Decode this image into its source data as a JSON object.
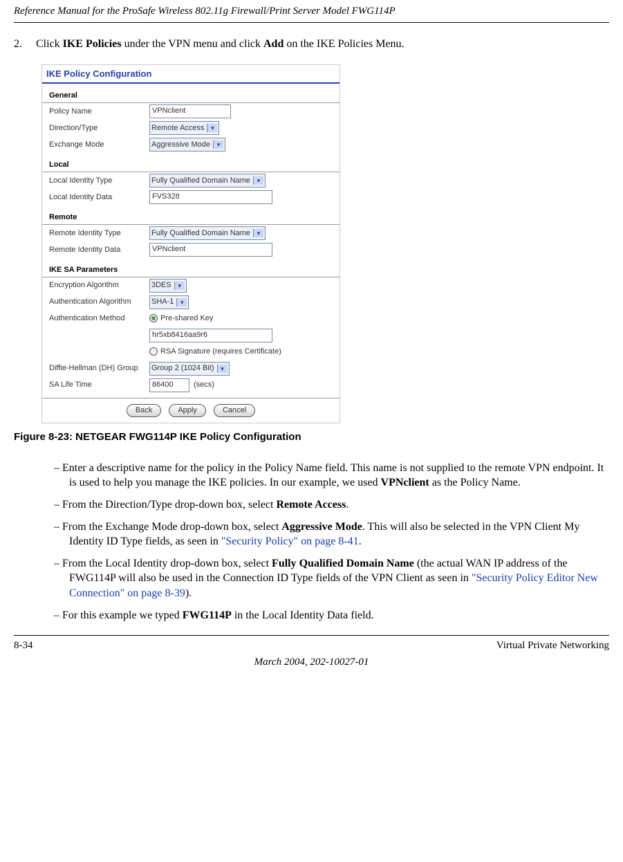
{
  "header": "Reference Manual for the ProSafe Wireless 802.11g  Firewall/Print Server Model FWG114P",
  "step": {
    "num": "2.",
    "pre": "Click ",
    "bold1": "IKE Policies",
    "mid": " under the VPN menu and click ",
    "bold2": "Add",
    "post": " on the IKE Policies Menu."
  },
  "figure": {
    "title": "IKE Policy Configuration",
    "sections": {
      "general": {
        "heading": "General",
        "policy_name_label": "Policy Name",
        "policy_name_value": "VPNclient",
        "direction_label": "Direction/Type",
        "direction_value": "Remote Access",
        "exchange_label": "Exchange Mode",
        "exchange_value": "Aggressive Mode"
      },
      "local": {
        "heading": "Local",
        "id_type_label": "Local Identity Type",
        "id_type_value": "Fully Qualified Domain Name",
        "id_data_label": "Local Identity Data",
        "id_data_value": "FVS328"
      },
      "remote": {
        "heading": "Remote",
        "id_type_label": "Remote Identity Type",
        "id_type_value": "Fully Qualified Domain Name",
        "id_data_label": "Remote Identity Data",
        "id_data_value": "VPNclient"
      },
      "ike": {
        "heading": "IKE SA Parameters",
        "enc_label": "Encryption Algorithm",
        "enc_value": "3DES",
        "auth_algo_label": "Authentication Algorithm",
        "auth_algo_value": "SHA-1",
        "auth_method_label": "Authentication Method",
        "auth_method_psk": "Pre-shared Key",
        "auth_method_psk_value": "hr5xb8416aa9r6",
        "auth_method_rsa": "RSA Signature (requires Certificate)",
        "dh_label": "Diffie-Hellman (DH) Group",
        "dh_value": "Group 2 (1024 Bit)",
        "sa_label": "SA Life Time",
        "sa_value": "86400",
        "sa_unit": "(secs)"
      }
    },
    "buttons": {
      "back": "Back",
      "apply": "Apply",
      "cancel": "Cancel"
    },
    "caption": "Figure 8-23:  NETGEAR FWG114P IKE Policy Configuration"
  },
  "bullets": {
    "b1a": "Enter a descriptive name for the policy in the Policy Name field. This name is not supplied to the remote VPN endpoint. It is used to help you manage the IKE policies. In our example, we used ",
    "b1b": "VPNclient",
    "b1c": " as the Policy Name.",
    "b2a": "From the Direction/Type drop-down box, select ",
    "b2b": "Remote Access",
    "b2c": ".",
    "b3a": "From the Exchange Mode drop-down box, select ",
    "b3b": "Aggressive Mode",
    "b3c": ". This will also be selected in the VPN Client My Identity ID Type fields, as seen in ",
    "b3link": "\"Security Policy\" on page 8-41",
    "b3d": ".",
    "b4a": "From the Local Identity drop-down box, select ",
    "b4b": "Fully Qualified Domain Name",
    "b4c": " (the actual WAN IP address of the FWG114P will also be used in the Connection ID Type fields of the VPN Client as seen in ",
    "b4link": "\"Security Policy Editor New Connection\" on page 8-39",
    "b4d": ").",
    "b5a": "For this example we typed ",
    "b5b": "FWG114P",
    "b5c": " in the Local Identity Data field."
  },
  "footer": {
    "left": "8-34",
    "right": "Virtual Private Networking",
    "center": "March 2004, 202-10027-01"
  }
}
